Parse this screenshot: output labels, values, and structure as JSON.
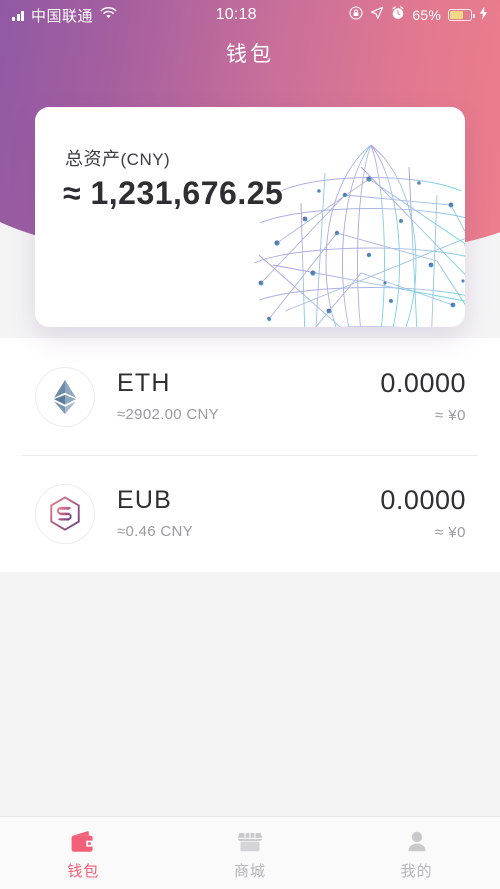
{
  "statusbar": {
    "signal_icon": "signal-bars-icon",
    "carrier": "中国联通",
    "wifi_icon": "wifi-icon",
    "time": "10:18",
    "rotation_lock_icon": "rotation-lock-icon",
    "location_icon": "location-arrow-icon",
    "alarm_icon": "alarm-clock-icon",
    "battery_percent": "65%",
    "battery_icon": "battery-icon",
    "charging_icon": "lightning-bolt-icon"
  },
  "header": {
    "title": "钱包",
    "gradient_start": "#8a57a6",
    "gradient_end": "#f07f8c"
  },
  "balance_card": {
    "label": "总资产",
    "currency": "(CNY)",
    "approx": "≈",
    "value": "1,231,676.25",
    "graphic": "network-globe-graphic"
  },
  "assets": [
    {
      "icon": "eth-coin-icon",
      "symbol": "ETH",
      "rate": "≈2902.00 CNY",
      "balance": "0.0000",
      "fiat": "≈ ¥0"
    },
    {
      "icon": "eub-coin-icon",
      "symbol": "EUB",
      "rate": "≈0.46 CNY",
      "balance": "0.0000",
      "fiat": "≈ ¥0"
    }
  ],
  "tabbar": {
    "active_color": "#f4607a",
    "inactive_color": "#b6b6bb",
    "tabs": [
      {
        "icon": "wallet-icon",
        "label": "钱包"
      },
      {
        "icon": "store-icon",
        "label": "商城"
      },
      {
        "icon": "person-icon",
        "label": "我的"
      }
    ]
  }
}
